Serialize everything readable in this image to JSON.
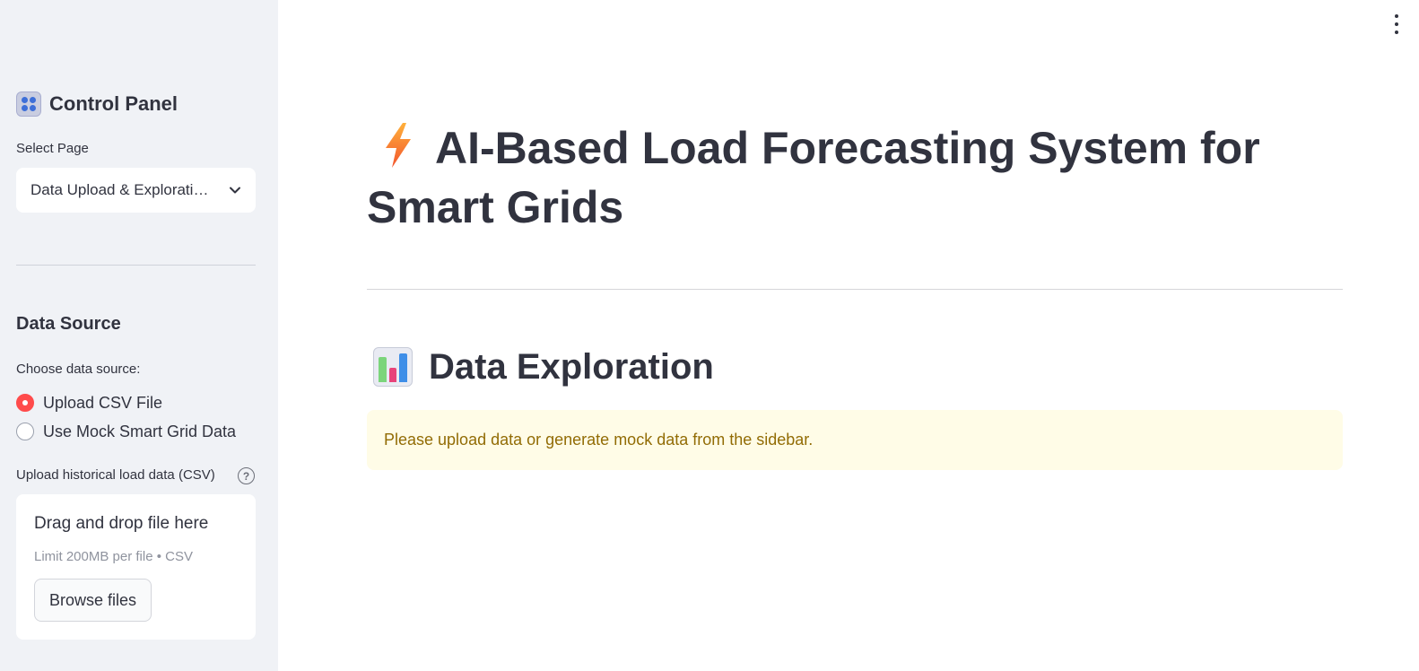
{
  "sidebar": {
    "title": "Control Panel",
    "title_icon": "control-knobs-icon",
    "select_page": {
      "label": "Select Page",
      "value": "Data Upload & Exploration"
    },
    "data_source": {
      "heading": "Data Source",
      "choose_label": "Choose data source:",
      "options": [
        {
          "label": "Upload CSV File",
          "selected": true
        },
        {
          "label": "Use Mock Smart Grid Data",
          "selected": false
        }
      ]
    },
    "uploader": {
      "label": "Upload historical load data (CSV)",
      "help_glyph": "?",
      "dropzone_title": "Drag and drop file here",
      "dropzone_hint": "Limit 200MB per file • CSV",
      "browse_label": "Browse files"
    }
  },
  "main": {
    "title_icon": "lightning-bolt-icon",
    "title": "AI-Based Load Forecasting System for Smart Grids",
    "section_icon": "bar-chart-icon",
    "section_title": "Data Exploration",
    "alert_text": "Please upload data or generate mock data from the sidebar."
  },
  "colors": {
    "sidebar_bg": "#f0f2f6",
    "radio_accent": "#ff4b4b",
    "alert_bg": "#fffce7",
    "alert_text": "#926c05",
    "text": "#31333f"
  }
}
